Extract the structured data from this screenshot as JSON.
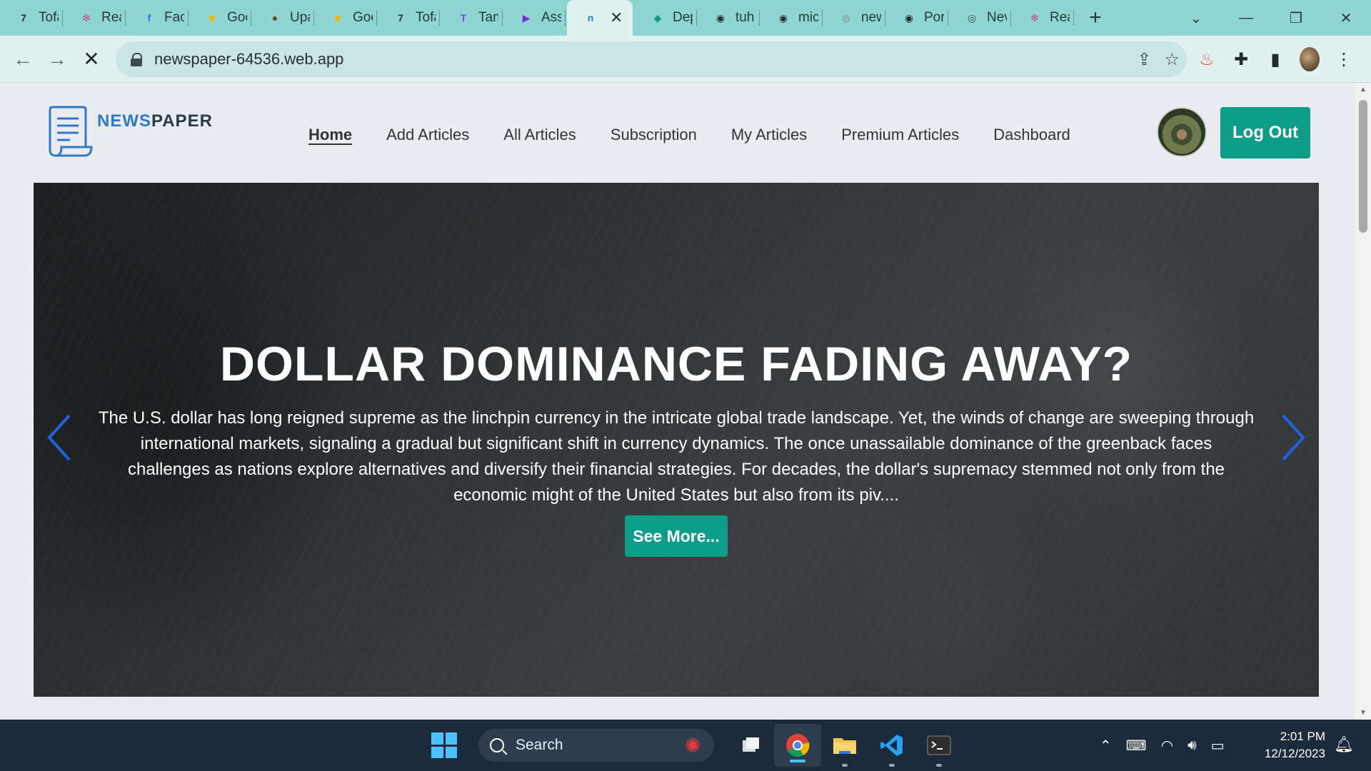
{
  "browser": {
    "tabs": [
      {
        "title": "Tofa",
        "icon": "tofa-icon",
        "color": "#1f3a38",
        "glyph": "7"
      },
      {
        "title": "Rea",
        "icon": "react-icon",
        "color": "#c0508a",
        "glyph": "✻"
      },
      {
        "title": "Fac",
        "icon": "facebook-icon",
        "color": "#1877f2",
        "glyph": "f"
      },
      {
        "title": "Goo",
        "icon": "google-meet-icon",
        "color": "#f4b400",
        "glyph": "■"
      },
      {
        "title": "Upa",
        "icon": "avatar-icon",
        "color": "#6b4a2c",
        "glyph": "●"
      },
      {
        "title": "Goo",
        "icon": "google-meet-icon",
        "color": "#f4b400",
        "glyph": "■"
      },
      {
        "title": "Tofa",
        "icon": "tofa-icon",
        "color": "#1f3a38",
        "glyph": "7"
      },
      {
        "title": "Tan",
        "icon": "tan-icon",
        "color": "#7b4cd8",
        "glyph": "T"
      },
      {
        "title": "Ass",
        "icon": "assistant-icon",
        "color": "#7b2cd8",
        "glyph": "▶"
      },
      {
        "title": "",
        "icon": "newspaper-icon",
        "color": "#2f7ac8",
        "glyph": "n",
        "active": true
      },
      {
        "title": "Dep",
        "icon": "deploy-icon",
        "color": "#0d9e8a",
        "glyph": "◆"
      },
      {
        "title": "tuh",
        "icon": "github-icon",
        "color": "#1f2a29",
        "glyph": "◉"
      },
      {
        "title": "mic",
        "icon": "github-icon",
        "color": "#1f2a29",
        "glyph": "◉"
      },
      {
        "title": "new",
        "icon": "globe-icon",
        "color": "#8a9596",
        "glyph": "◍"
      },
      {
        "title": "Por",
        "icon": "github-icon",
        "color": "#1f2a29",
        "glyph": "◉"
      },
      {
        "title": "Nev",
        "icon": "chrome-icon",
        "color": "#3c4a49",
        "glyph": "◎"
      },
      {
        "title": "Rea",
        "icon": "react-icon",
        "color": "#c0508a",
        "glyph": "✻"
      }
    ],
    "new_tab": "+",
    "url": "newspaper-64536.web.app"
  },
  "site": {
    "logo_news": "NEWS",
    "logo_paper": "PAPER",
    "nav": [
      "Home",
      "Add Articles",
      "All Articles",
      "Subscription",
      "My Articles",
      "Premium Articles",
      "Dashboard"
    ],
    "active_nav": "Home",
    "logout_label": "Log Out",
    "accent_color": "#0d9e8a"
  },
  "hero": {
    "title": "DOLLAR DOMINANCE FADING AWAY?",
    "text": "The U.S. dollar has long reigned supreme as the linchpin currency in the intricate global trade landscape. Yet, the winds of change are sweeping through international markets, signaling a gradual but significant shift in currency dynamics. The once unassailable dominance of the greenback faces challenges as nations explore alternatives and diversify their financial strategies. For decades, the dollar's supremacy stemmed not only from the economic might of the United States but also from its piv....",
    "button_label": "See More..."
  },
  "taskbar": {
    "search_label": "Search",
    "time": "2:01 PM",
    "date": "12/12/2023"
  }
}
